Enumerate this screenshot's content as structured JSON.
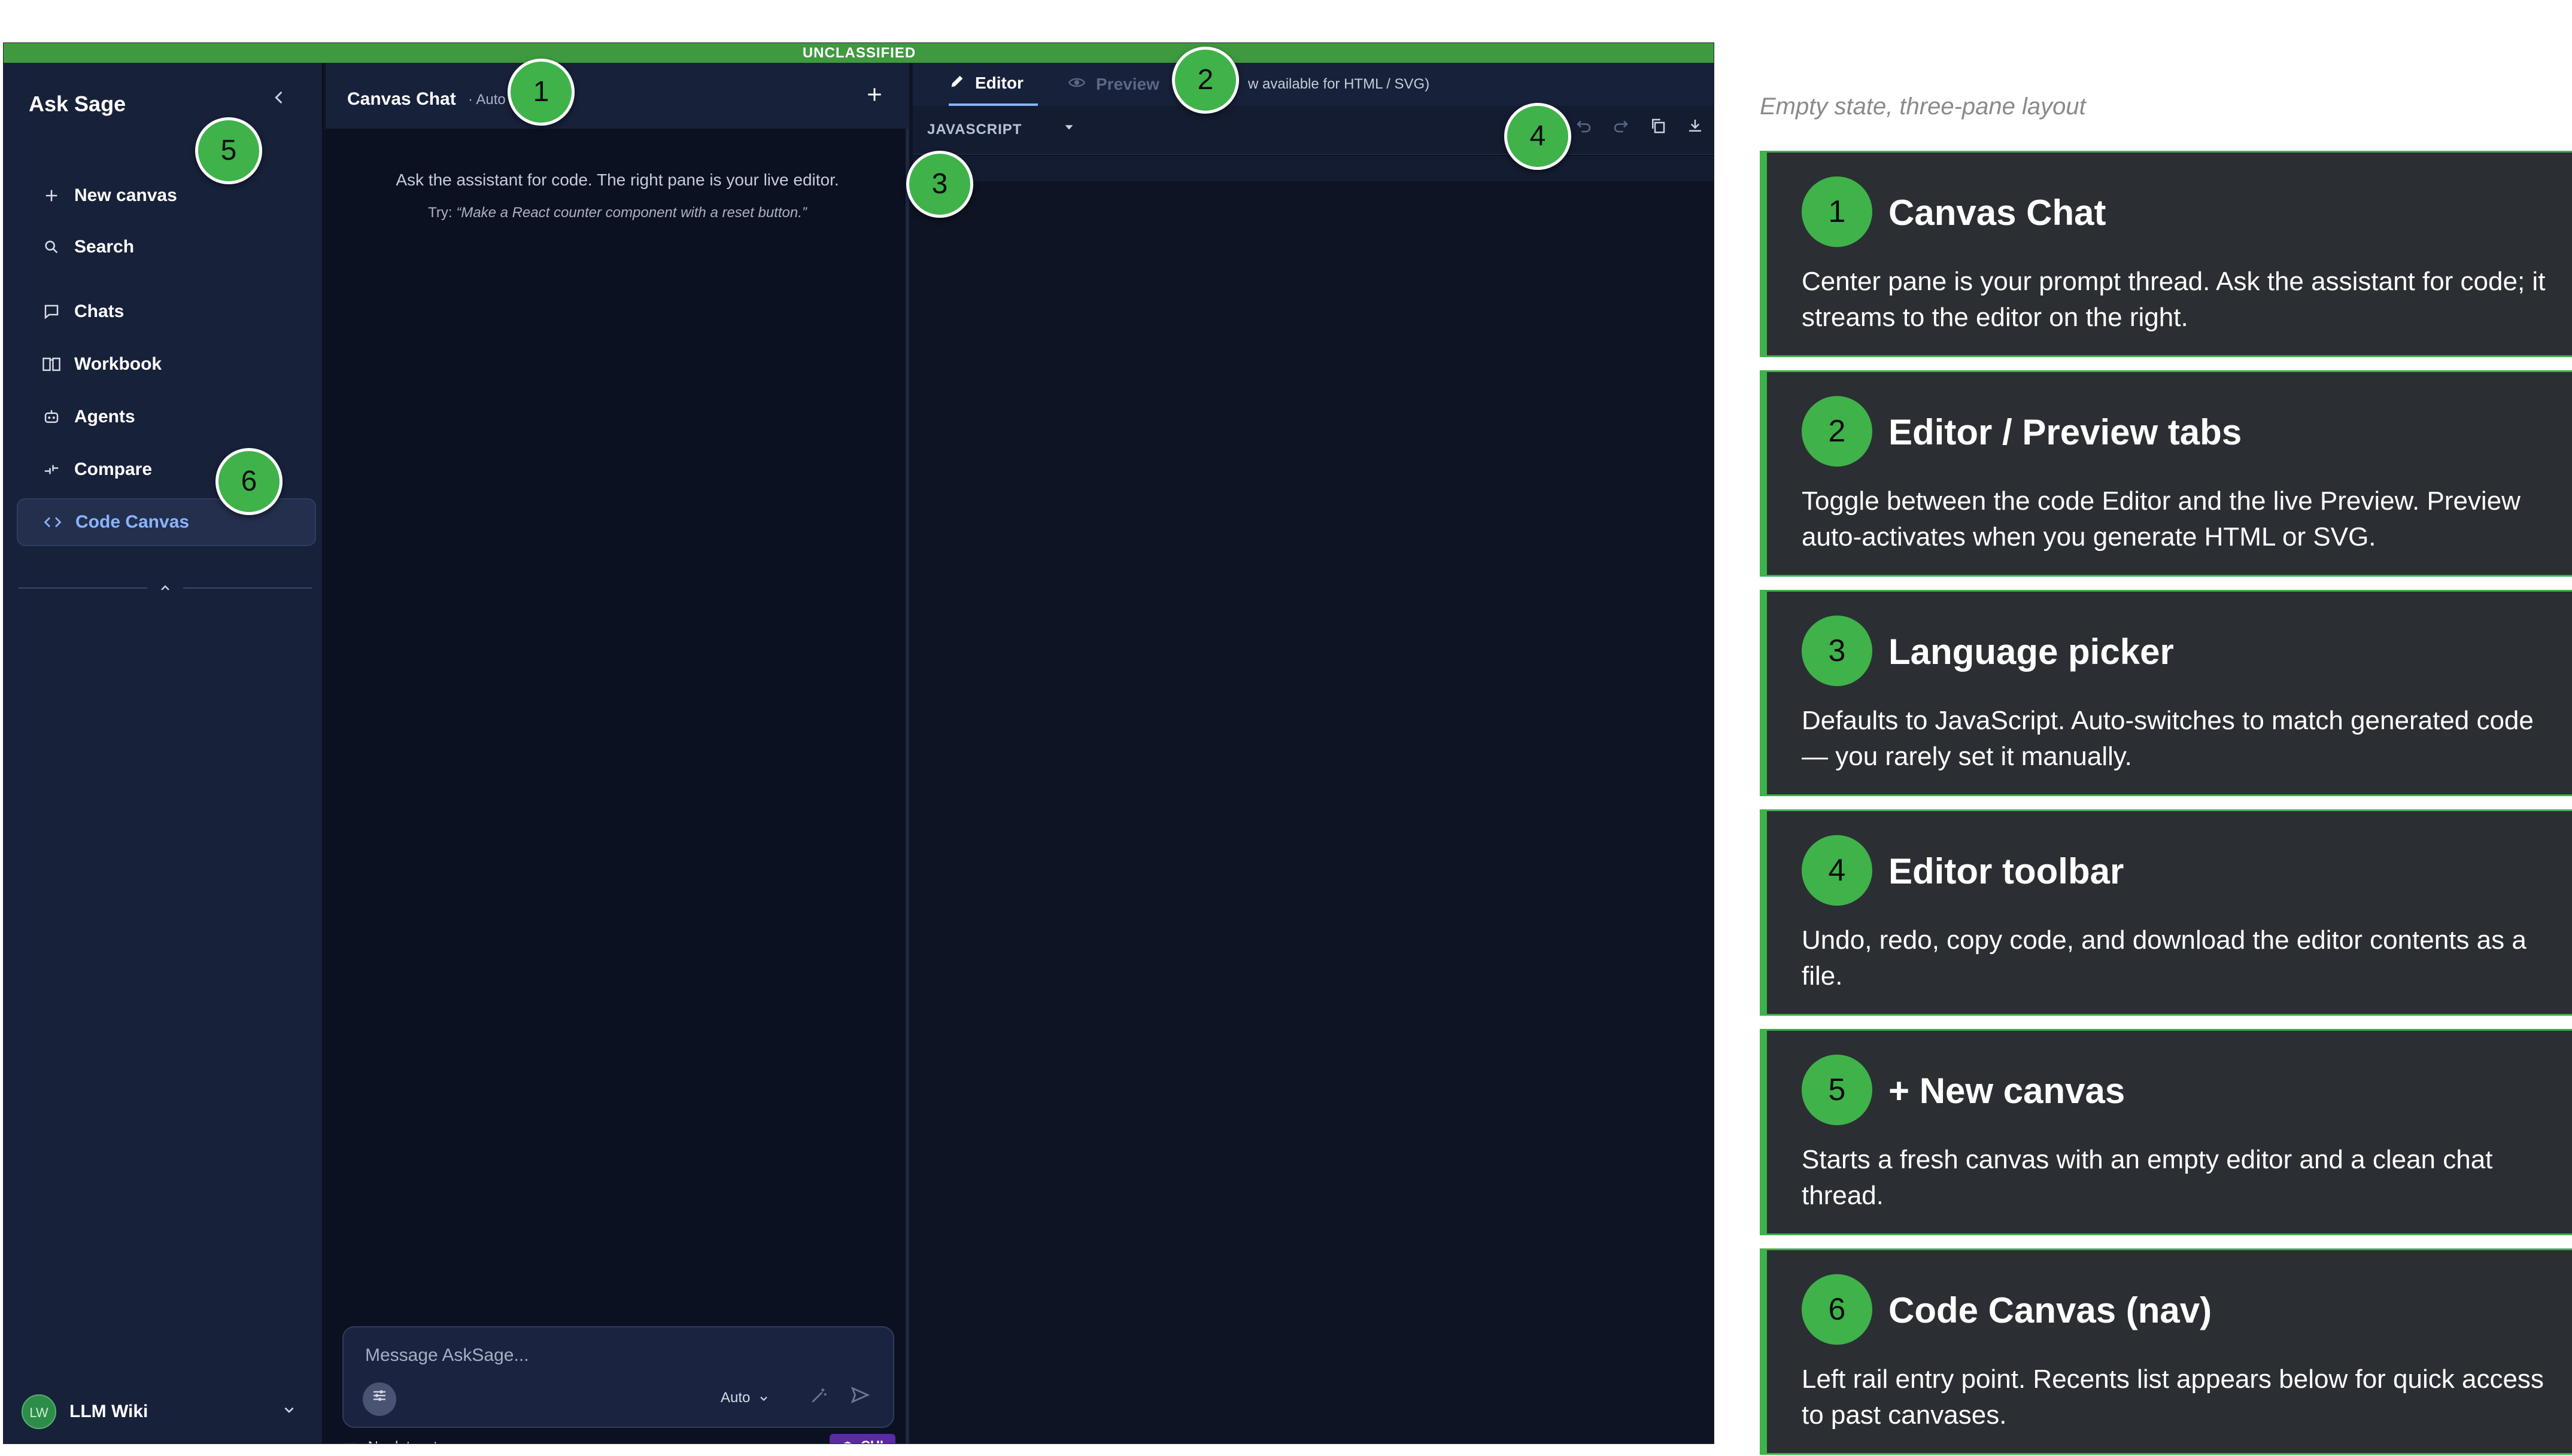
{
  "banner": {
    "text": "UNCLASSIFIED"
  },
  "sidebar": {
    "brand": "Ask Sage",
    "items": [
      {
        "label": "New canvas",
        "icon": "plus-icon"
      },
      {
        "label": "Search",
        "icon": "search-icon"
      },
      {
        "label": "Chats",
        "icon": "chat-bubble-icon"
      },
      {
        "label": "Workbook",
        "icon": "book-icon"
      },
      {
        "label": "Agents",
        "icon": "robot-icon"
      },
      {
        "label": "Compare",
        "icon": "compare-icon"
      },
      {
        "label": "Code Canvas",
        "icon": "code-icon",
        "active": true
      }
    ],
    "user": {
      "initials": "LW",
      "name": "LLM Wiki"
    }
  },
  "chat": {
    "title": "Canvas Chat",
    "subtitle": "· Auto",
    "empty_text": "Ask the assistant for code. The right pane is your live editor.",
    "try_prefix": "Try:",
    "try_example": "“Make a React counter component with a reset button.”",
    "composer": {
      "placeholder": "Message AskSage...",
      "model": "Auto"
    },
    "datasets": "No datasets",
    "cui_badge": "CUI"
  },
  "editor": {
    "tabs": [
      {
        "label": "Editor",
        "active": true
      },
      {
        "label": "Preview",
        "active": false
      }
    ],
    "preview_hint": "w available for HTML / SVG)",
    "language": "JAVASCRIPT"
  },
  "callouts": [
    "1",
    "2",
    "3",
    "4",
    "5",
    "6"
  ],
  "panel": {
    "caption": "Empty state, three-pane layout",
    "accent": "#3fb24a",
    "cards": [
      {
        "num": "1",
        "title": "Canvas Chat",
        "desc": "Center pane is your prompt thread. Ask the assistant for code; it streams to the editor on the right."
      },
      {
        "num": "2",
        "title": "Editor / Preview tabs",
        "desc": "Toggle between the code Editor and the live Preview. Preview auto-activates when you generate HTML or SVG."
      },
      {
        "num": "3",
        "title": "Language picker",
        "desc": "Defaults to JavaScript. Auto-switches to match generated code — you rarely set it manually."
      },
      {
        "num": "4",
        "title": "Editor toolbar",
        "desc": "Undo, redo, copy code, and download the editor contents as a file."
      },
      {
        "num": "5",
        "title": "+ New canvas",
        "desc": "Starts a fresh canvas with an empty editor and a clean chat thread."
      },
      {
        "num": "6",
        "title": "Code Canvas (nav)",
        "desc": "Left rail entry point. Recents list appears below for quick access to past canvases."
      }
    ]
  }
}
